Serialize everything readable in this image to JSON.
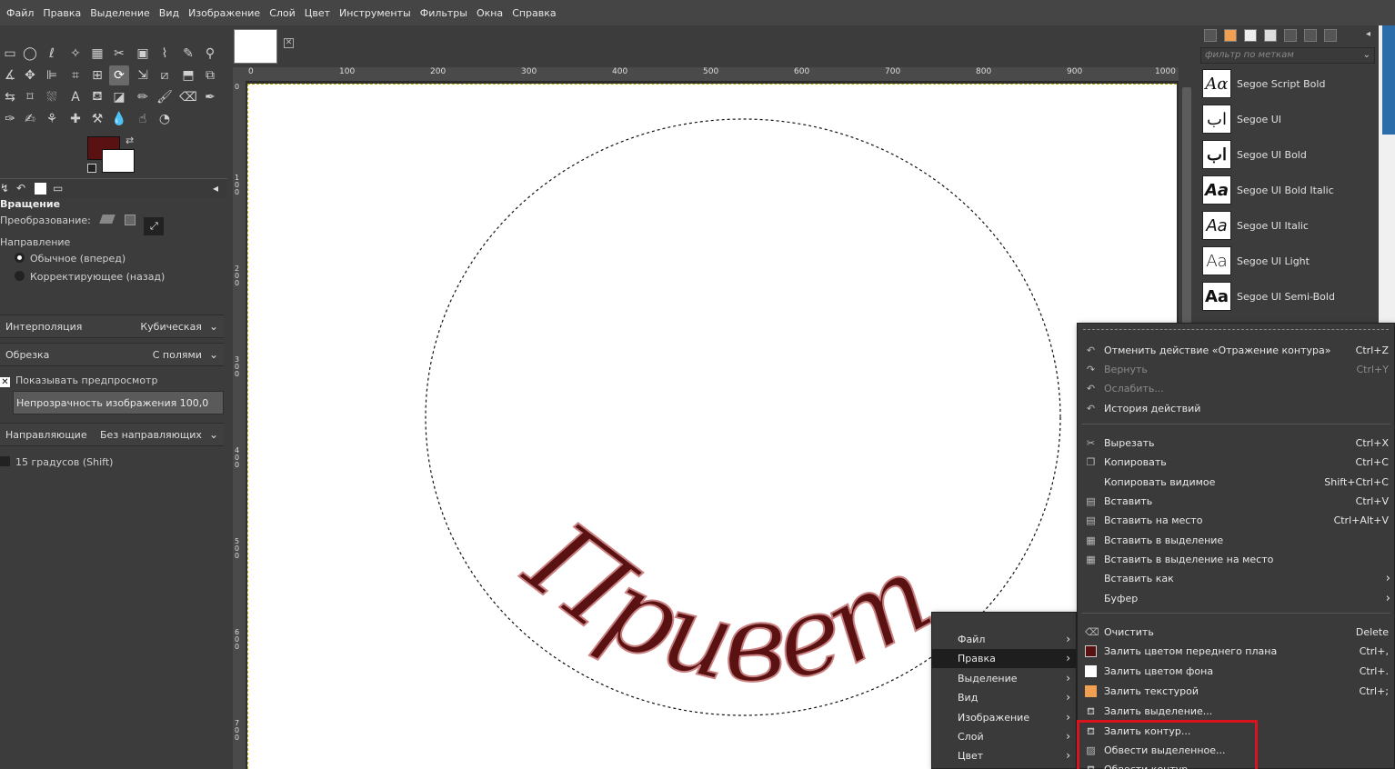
{
  "menubar": [
    "Файл",
    "Правка",
    "Выделение",
    "Вид",
    "Изображение",
    "Слой",
    "Цвет",
    "Инструменты",
    "Фильтры",
    "Окна",
    "Справка"
  ],
  "tool_options": {
    "title": "Вращение",
    "transform_label": "Преобразование:",
    "direction_label": "Направление",
    "direction_forward": "Обычное (вперед)",
    "direction_back": "Корректирующее (назад)",
    "interp_label": "Интерполяция",
    "interp_value": "Кубическая",
    "clip_label": "Обрезка",
    "clip_value": "С полями",
    "preview_label": "Показывать предпросмотр",
    "opacity_label": "Непрозрачность изображения",
    "opacity_value": "100,0",
    "guides_label": "Направляющие",
    "guides_value": "Без направляющих",
    "snap_label": "15 градусов (Shift)"
  },
  "colors": {
    "foreground": "#5a1111",
    "background": "#ffffff",
    "pattern": "#f0a050"
  },
  "ruler_top": [
    "0",
    "100",
    "200",
    "300",
    "400",
    "500",
    "600",
    "700",
    "800",
    "900",
    "1000"
  ],
  "ruler_left": [
    "0",
    "100",
    "200",
    "300",
    "400",
    "500",
    "600",
    "700"
  ],
  "canvas_text": "Привет",
  "font_panel": {
    "filter_placeholder": "фильтр по меткам",
    "fonts": [
      {
        "preview": "Aα",
        "name": "Segoe Script Bold"
      },
      {
        "preview": "اب",
        "name": "Segoe UI"
      },
      {
        "preview": "اب",
        "name": "Segoe UI Bold"
      },
      {
        "preview": "Aa",
        "name": "Segoe UI Bold Italic"
      },
      {
        "preview": "Aa",
        "name": "Segoe UI Italic"
      },
      {
        "preview": "Aa",
        "name": "Segoe UI Light"
      },
      {
        "preview": "Aa",
        "name": "Segoe UI Semi-Bold"
      }
    ]
  },
  "submenu": [
    "Файл",
    "Правка",
    "Выделение",
    "Вид",
    "Изображение",
    "Слой",
    "Цвет"
  ],
  "edit_menu": {
    "undo": {
      "label": "Отменить действие «Отражение контура»",
      "shortcut": "Ctrl+Z"
    },
    "redo": {
      "label": "Вернуть",
      "shortcut": "Ctrl+Y"
    },
    "fade": {
      "label": "Ослабить..."
    },
    "history": {
      "label": "История действий"
    },
    "cut": {
      "label": "Вырезать",
      "shortcut": "Ctrl+X"
    },
    "copy": {
      "label": "Копировать",
      "shortcut": "Ctrl+C"
    },
    "copy_visible": {
      "label": "Копировать видимое",
      "shortcut": "Shift+Ctrl+C"
    },
    "paste": {
      "label": "Вставить",
      "shortcut": "Ctrl+V"
    },
    "paste_in_place": {
      "label": "Вставить на место",
      "shortcut": "Ctrl+Alt+V"
    },
    "paste_into": {
      "label": "Вставить в выделение"
    },
    "paste_into_in_place": {
      "label": "Вставить в выделение на место"
    },
    "paste_as": {
      "label": "Вставить как"
    },
    "buffer": {
      "label": "Буфер"
    },
    "clear": {
      "label": "Очистить",
      "shortcut": "Delete"
    },
    "fill_fg": {
      "label": "Залить цветом переднего плана",
      "shortcut": "Ctrl+,"
    },
    "fill_bg": {
      "label": "Залить цветом фона",
      "shortcut": "Ctrl+."
    },
    "fill_pattern": {
      "label": "Залить текстурой",
      "shortcut": "Ctrl+;"
    },
    "fill_selection": {
      "label": "Залить выделение..."
    },
    "fill_path": {
      "label": "Залить контур..."
    },
    "stroke_selection": {
      "label": "Обвести выделенное..."
    },
    "stroke_path": {
      "label": "Обвести контур..."
    }
  }
}
